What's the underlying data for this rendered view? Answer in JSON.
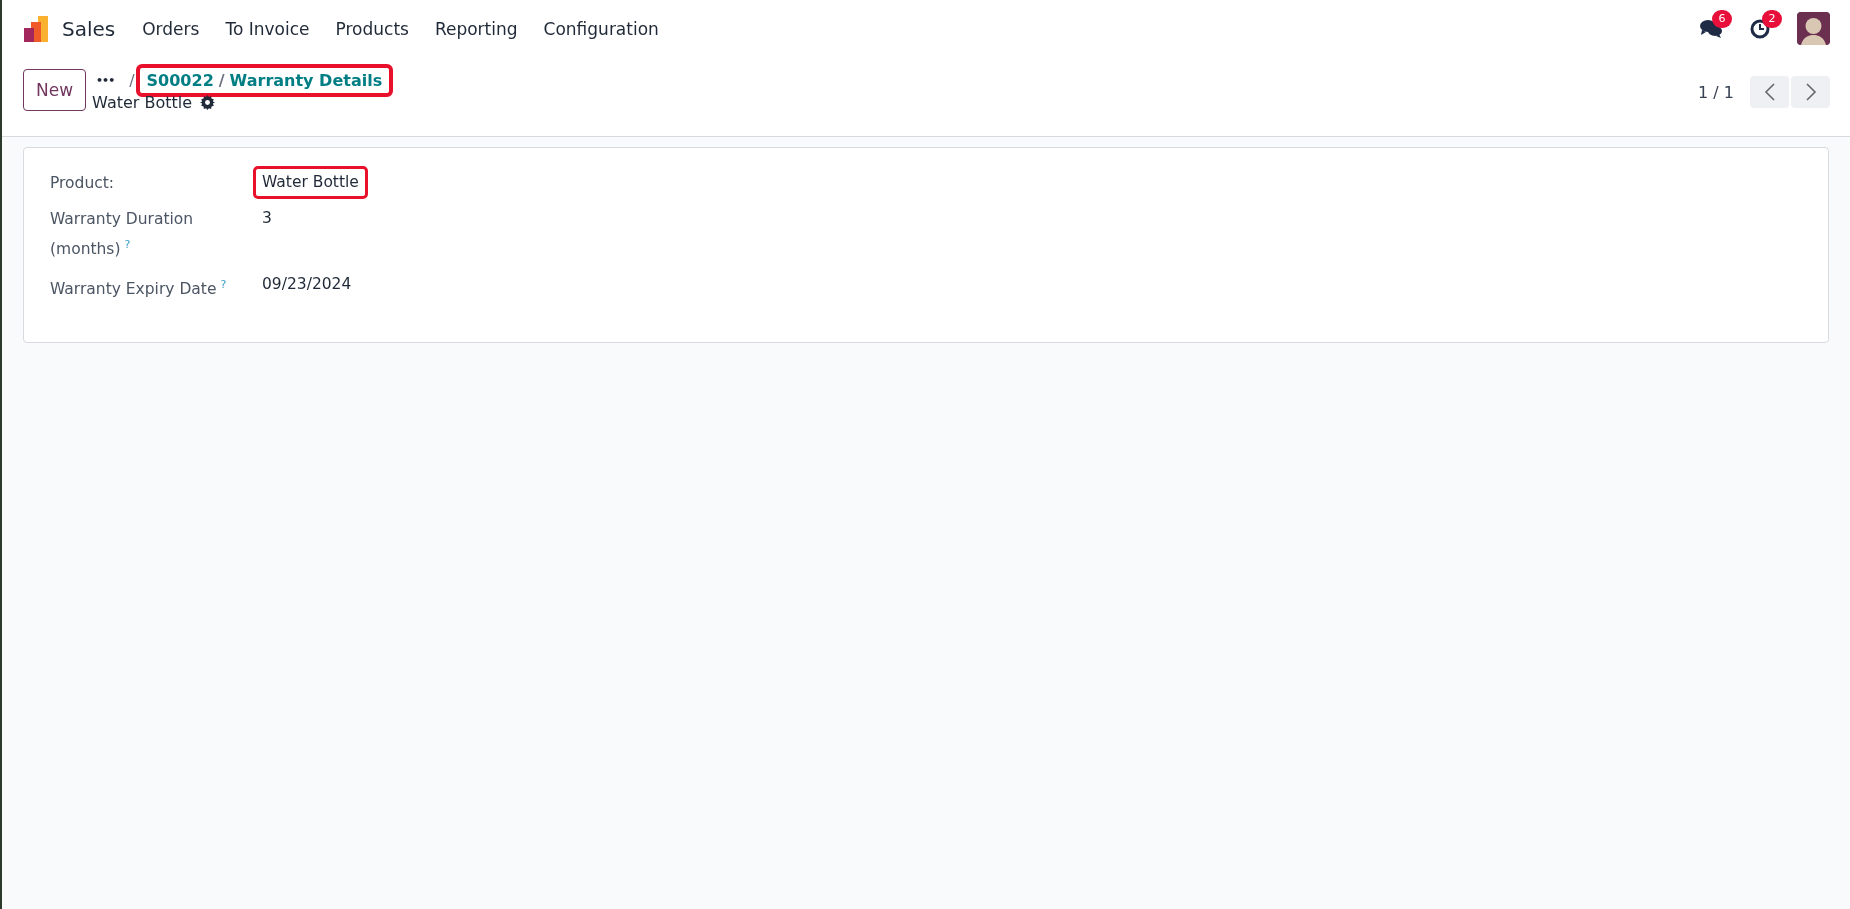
{
  "navbar": {
    "app_name": "Sales",
    "menu": [
      "Orders",
      "To Invoice",
      "Products",
      "Reporting",
      "Configuration"
    ],
    "messages_badge": "6",
    "activities_badge": "2"
  },
  "control_panel": {
    "new_button": "New",
    "more": "•••",
    "breadcrumb_separator": "/",
    "breadcrumb": [
      "S00022",
      "Warranty Details"
    ],
    "crumb_separator": "/",
    "breadcrumb_highlighted": true,
    "record_title": "Water Bottle",
    "pager": "1 / 1"
  },
  "form": {
    "fields": [
      {
        "label": "Product:",
        "value": "Water Bottle",
        "highlighted": true
      },
      {
        "label": "Warranty Duration (months)",
        "help": "?",
        "value": "3",
        "highlighted": false
      },
      {
        "label": "Warranty Expiry Date",
        "help": "?",
        "value": "09/23/2024",
        "highlighted": false
      }
    ]
  }
}
